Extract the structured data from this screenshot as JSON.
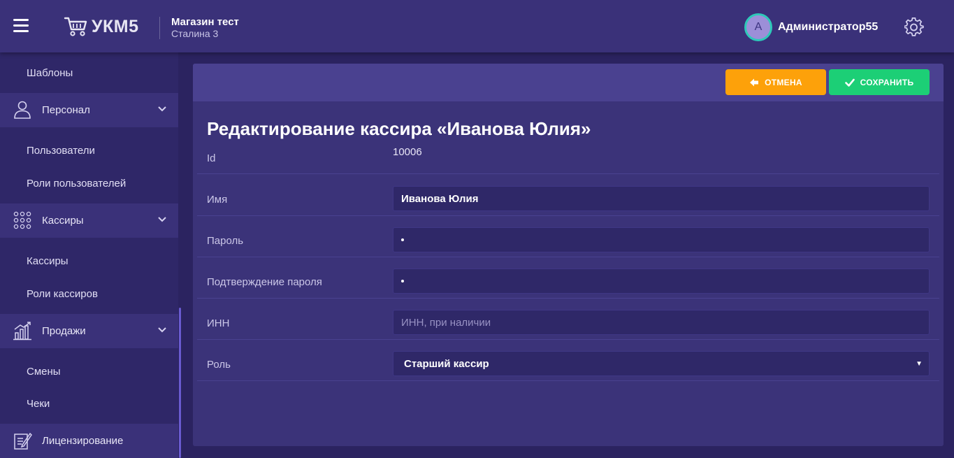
{
  "header": {
    "logo_text": "УКМ5",
    "store_name": "Магазин тест",
    "store_address": "Сталина 3",
    "avatar_letter": "А",
    "username": "Администратор55"
  },
  "sidebar": {
    "templates": "Шаблоны",
    "groups": [
      {
        "label": "Персонал",
        "icon": "user-icon",
        "items": [
          "Пользователи",
          "Роли пользователей"
        ]
      },
      {
        "label": "Кассиры",
        "icon": "grid-dots-icon",
        "items": [
          "Кассиры",
          "Роли кассиров"
        ]
      },
      {
        "label": "Продажи",
        "icon": "bar-chart-icon",
        "items": [
          "Смены",
          "Чеки"
        ]
      },
      {
        "label": "Лицензирование",
        "icon": "edit-document-icon",
        "items": []
      }
    ]
  },
  "actions": {
    "cancel_label": "ОТМЕНА",
    "save_label": "СОХРАНИТЬ"
  },
  "form": {
    "title": "Редактирование кассира «Иванова Юлия»",
    "id_label": "Id",
    "id_value": "10006",
    "name_label": "Имя",
    "name_value": "Иванова Юлия",
    "password_label": "Пароль",
    "password_confirm_label": "Подтверждение пароля",
    "inn_label": "ИНН",
    "inn_placeholder": "ИНН, при наличии",
    "role_label": "Роль",
    "role_value": "Старший кассир"
  },
  "colors": {
    "topbar": "#3a3179",
    "sidebar": "#2f2768",
    "card": "#3b3379",
    "cancel": "#fda10a",
    "save": "#1ccf76",
    "avatar_ring": "#2ec9b9"
  }
}
